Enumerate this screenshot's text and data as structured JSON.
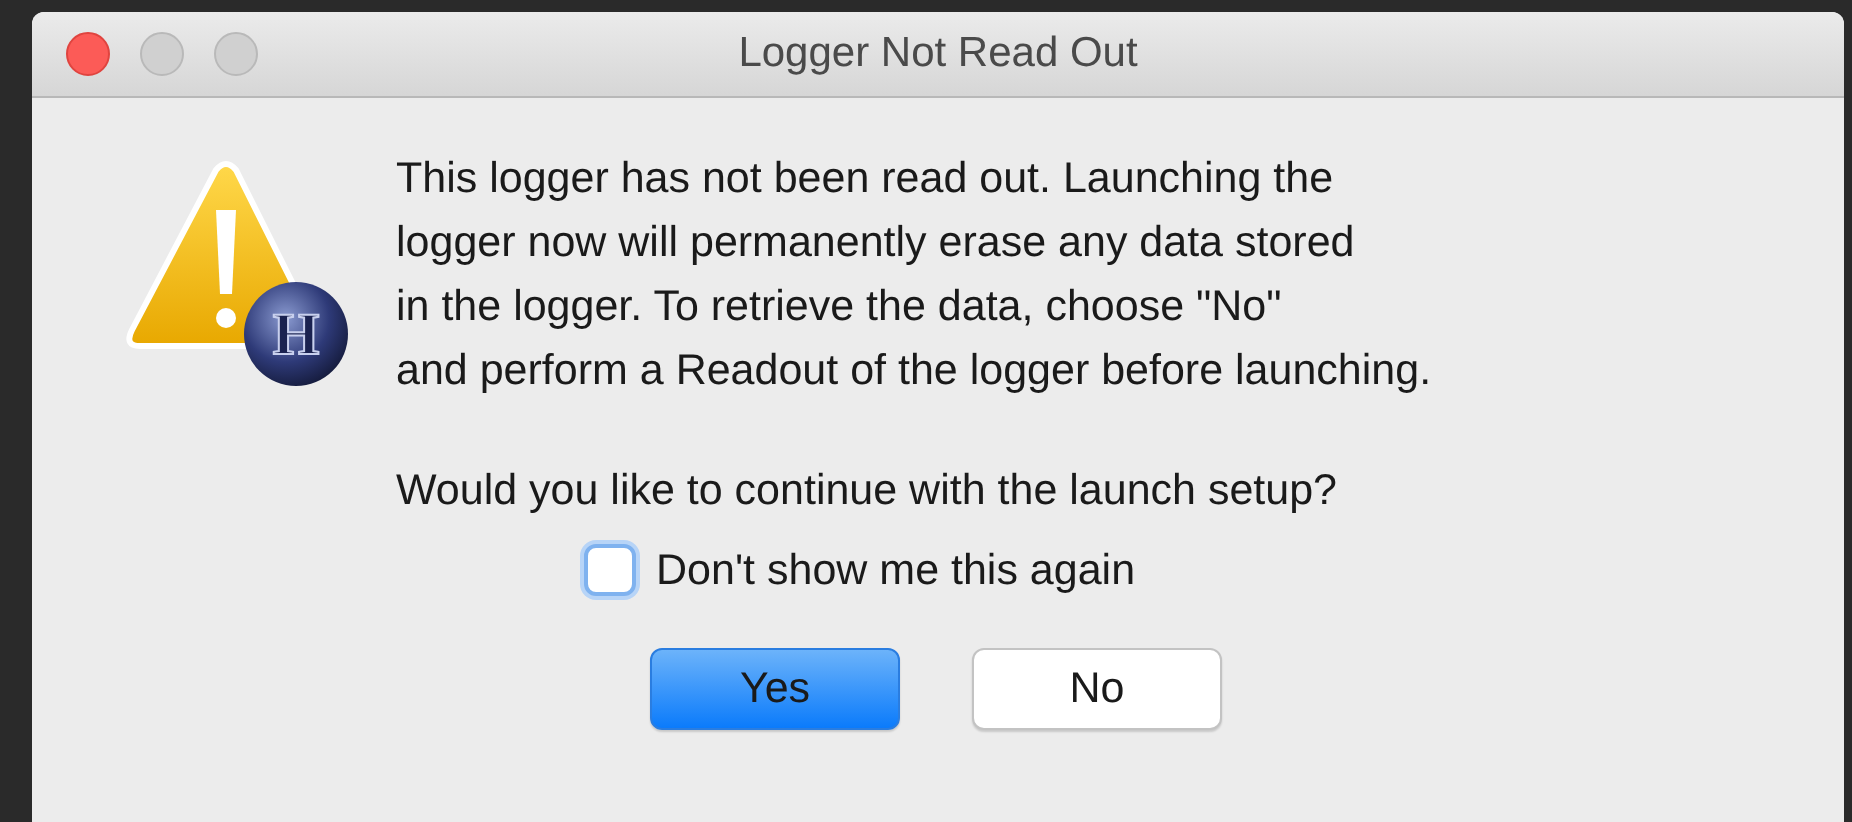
{
  "window": {
    "title": "Logger Not Read Out",
    "controls": [
      {
        "kind": "close"
      },
      {
        "kind": "minimize"
      },
      {
        "kind": "zoom"
      }
    ]
  },
  "icon": {
    "badge_letter": "H"
  },
  "message": "This logger has not been read out. Launching the\nlogger now will permanently erase any data stored\nin the logger. To retrieve the data, choose \"No\"\nand perform a Readout of the logger before launching.",
  "question": "Would you like to continue with the launch setup?",
  "checkbox": {
    "label": "Don't show me this again",
    "checked": false
  },
  "buttons": [
    {
      "label": "Yes",
      "default": true
    },
    {
      "label": "No",
      "default": false
    }
  ]
}
